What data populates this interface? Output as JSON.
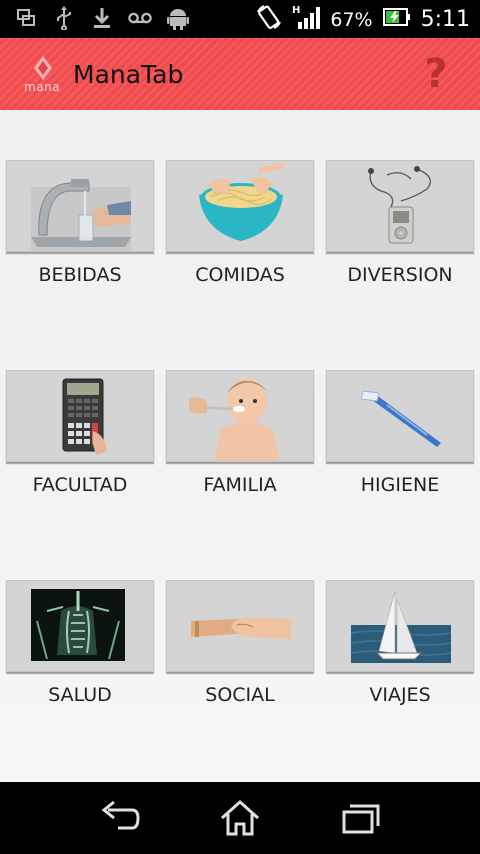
{
  "status_bar": {
    "battery_pct": "67%",
    "time": "5:11",
    "icons": [
      "screen-mirror-icon",
      "usb-icon",
      "download-icon",
      "voicemail-icon",
      "android-icon",
      "screen-rotate-icon",
      "signal-h-icon",
      "battery-charging-icon"
    ]
  },
  "action_bar": {
    "logo_text": "mana",
    "title": "ManaTab",
    "help_label": "?"
  },
  "categories": [
    {
      "label": "BEBIDAS",
      "icon": "faucet-glass-image"
    },
    {
      "label": "COMIDAS",
      "icon": "spaghetti-bowl-image"
    },
    {
      "label": "DIVERSION",
      "icon": "ipod-image"
    },
    {
      "label": "FACULTAD",
      "icon": "calculator-image"
    },
    {
      "label": "FAMILIA",
      "icon": "baby-feeding-image"
    },
    {
      "label": "HIGIENE",
      "icon": "toothbrush-image"
    },
    {
      "label": "SALUD",
      "icon": "xray-image"
    },
    {
      "label": "SOCIAL",
      "icon": "handshake-image"
    },
    {
      "label": "VIAJES",
      "icon": "sailboat-image"
    }
  ],
  "nav_bar": {
    "icons": [
      "back-icon",
      "home-icon",
      "recent-apps-icon"
    ]
  }
}
